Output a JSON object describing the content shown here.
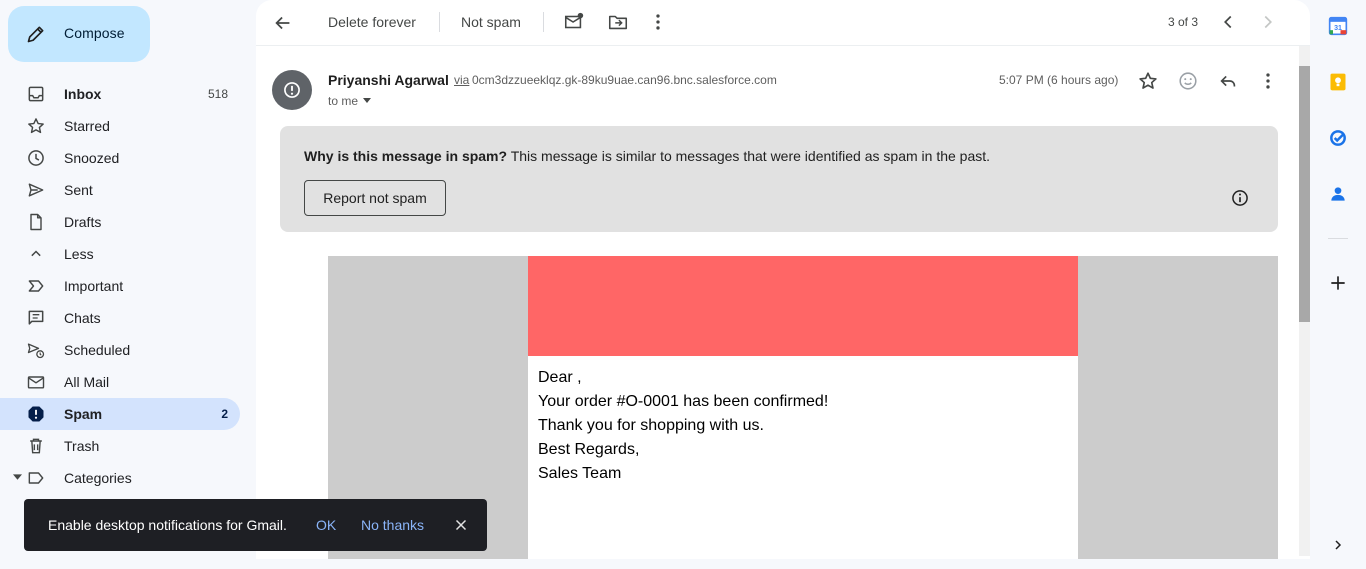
{
  "compose": {
    "label": "Compose"
  },
  "nav": [
    {
      "label": "Inbox",
      "count": "518",
      "icon": "inbox-icon"
    },
    {
      "label": "Starred",
      "count": "",
      "icon": "star-icon"
    },
    {
      "label": "Snoozed",
      "count": "",
      "icon": "clock-icon"
    },
    {
      "label": "Sent",
      "count": "",
      "icon": "send-icon"
    },
    {
      "label": "Drafts",
      "count": "",
      "icon": "draft-icon"
    },
    {
      "label": "Less",
      "count": "",
      "icon": "chevron-up-icon"
    },
    {
      "label": "Important",
      "count": "",
      "icon": "important-icon"
    },
    {
      "label": "Chats",
      "count": "",
      "icon": "chat-icon"
    },
    {
      "label": "Scheduled",
      "count": "",
      "icon": "scheduled-icon"
    },
    {
      "label": "All Mail",
      "count": "",
      "icon": "all-mail-icon"
    },
    {
      "label": "Spam",
      "count": "2",
      "icon": "spam-icon"
    },
    {
      "label": "Trash",
      "count": "",
      "icon": "trash-icon"
    },
    {
      "label": "Categories",
      "count": "",
      "icon": "label-icon"
    }
  ],
  "toolbar": {
    "delete_forever": "Delete forever",
    "not_spam": "Not spam",
    "pager": "3 of 3"
  },
  "message": {
    "sender": "Priyanshi Agarwal",
    "via": "via",
    "via_address": "0cm3dzzueeklqz.gk-89ku9uae.can96.bnc.salesforce.com",
    "to": "to me",
    "time": "5:07 PM (6 hours ago)"
  },
  "spam_notice": {
    "question": "Why is this message in spam?",
    "explanation": " This message is similar to messages that were identified as spam in the past.",
    "button": "Report not spam"
  },
  "email": {
    "line1": "Dear ,",
    "line2": "Your order #O-0001 has been confirmed!",
    "line3": "Thank you for shopping with us.",
    "line4": "Best Regards,",
    "line5": "Sales Team",
    "banner_color": "#ff6666"
  },
  "toast": {
    "message": "Enable desktop notifications for Gmail.",
    "ok": "OK",
    "no_thanks": "No thanks"
  },
  "rail": {
    "calendar_day": "31"
  },
  "colors": {
    "accent": "#c2e7ff",
    "active_nav": "#d3e3fd"
  }
}
